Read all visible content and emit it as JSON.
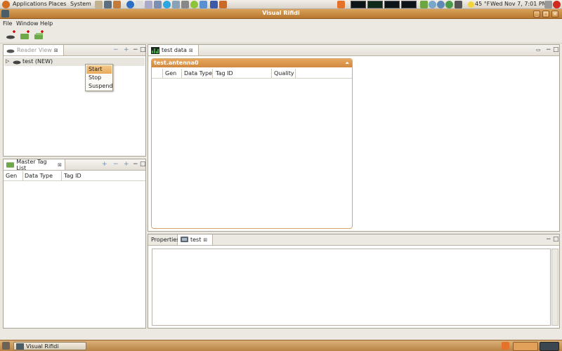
{
  "top_panel": {
    "menus": [
      "Applications",
      "Places",
      "System"
    ],
    "clock": "Wed Nov  7,  7:01 PM",
    "weather": "45 °F"
  },
  "window": {
    "title": "Visual Rifidi"
  },
  "menubar": {
    "file": "File",
    "window": "Window",
    "help": "Help"
  },
  "reader_view": {
    "tab_label": "Reader View",
    "tree_item": "test (NEW)",
    "context_menu": [
      "Start",
      "Stop",
      "Suspend"
    ],
    "context_selected": "Start"
  },
  "master_tag_list": {
    "tab_label": "Master Tag List",
    "columns": [
      "Gen",
      "Data Type",
      "Tag ID"
    ]
  },
  "test_data": {
    "tab_label": "test data",
    "panel_title": "test.antenna0",
    "columns": [
      "Gen",
      "Data Type",
      "Tag ID",
      "Quality"
    ]
  },
  "properties": {
    "tab_label": "Properties",
    "tab2_label": "test"
  },
  "taskbar": {
    "item": "Visual Rifidi"
  },
  "colors": {
    "accent": "#d0883e",
    "selection": "#e9aa5a",
    "window_bg": "#ece9e3"
  }
}
